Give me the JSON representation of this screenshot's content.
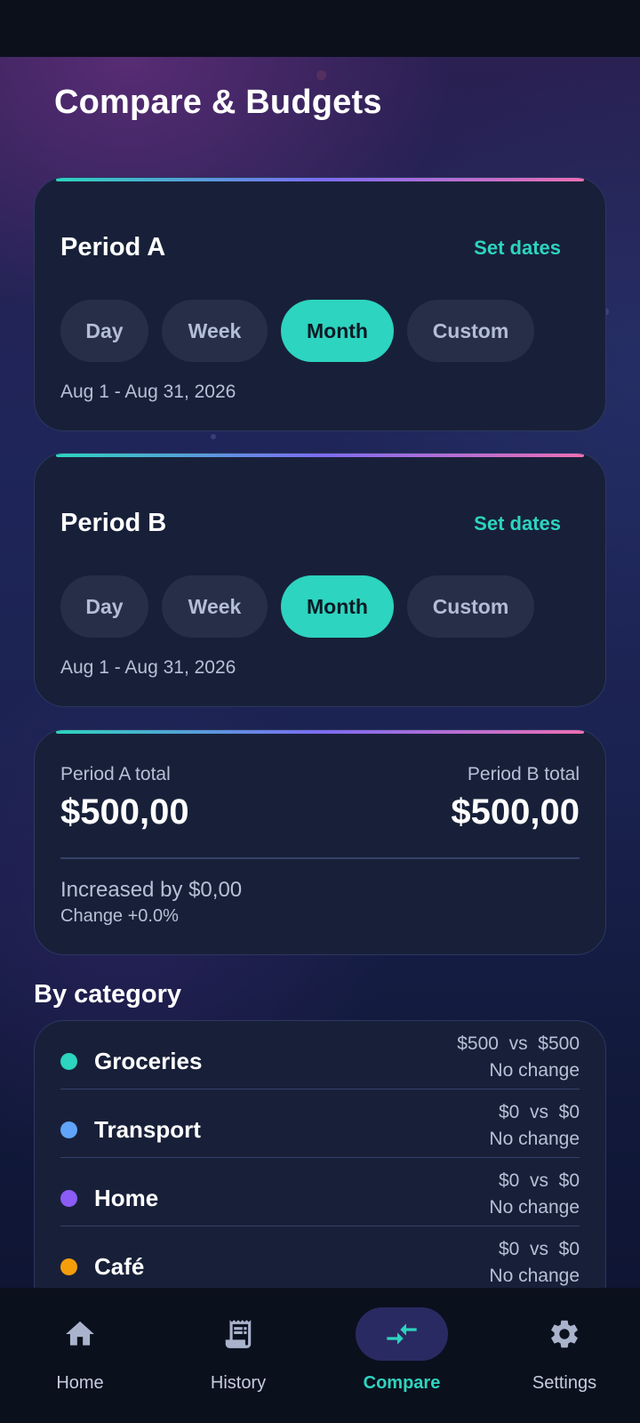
{
  "header": {
    "title": "Compare & Budgets"
  },
  "period_a": {
    "title": "Period A",
    "set_dates_label": "Set dates",
    "chips": [
      "Day",
      "Week",
      "Month",
      "Custom"
    ],
    "selected_chip": "Month",
    "range_text": "Aug 1 - Aug 31, 2026"
  },
  "period_b": {
    "title": "Period B",
    "set_dates_label": "Set dates",
    "chips": [
      "Day",
      "Week",
      "Month",
      "Custom"
    ],
    "selected_chip": "Month",
    "range_text": "Aug 1 - Aug 31, 2026"
  },
  "totals": {
    "a_label": "Period A total",
    "a_value": "$500,00",
    "b_label": "Period B total",
    "b_value": "$500,00",
    "increase_text": "Increased by $0,00",
    "change_text": "Change  +0.0%"
  },
  "by_category": {
    "title": "By category",
    "items": [
      {
        "name": "Groceries",
        "a": "$500",
        "vs": "vs",
        "b": "$500",
        "change": "No change",
        "color": "#2dd4bf"
      },
      {
        "name": "Transport",
        "a": "$0",
        "vs": "vs",
        "b": "$0",
        "change": "No change",
        "color": "#60a5fa"
      },
      {
        "name": "Home",
        "a": "$0",
        "vs": "vs",
        "b": "$0",
        "change": "No change",
        "color": "#8b5cf6"
      },
      {
        "name": "Café",
        "a": "$0",
        "vs": "vs",
        "b": "$0",
        "change": "No change",
        "color": "#f59e0b"
      }
    ]
  },
  "nav": {
    "items": [
      {
        "label": "Home",
        "icon": "home-icon"
      },
      {
        "label": "History",
        "icon": "receipt-icon"
      },
      {
        "label": "Compare",
        "icon": "compare-arrows-icon"
      },
      {
        "label": "Settings",
        "icon": "gear-icon"
      }
    ],
    "active": "Compare"
  },
  "colors": {
    "accent": "#2dd4bf",
    "background": "#1b2352",
    "card": "#182039"
  }
}
